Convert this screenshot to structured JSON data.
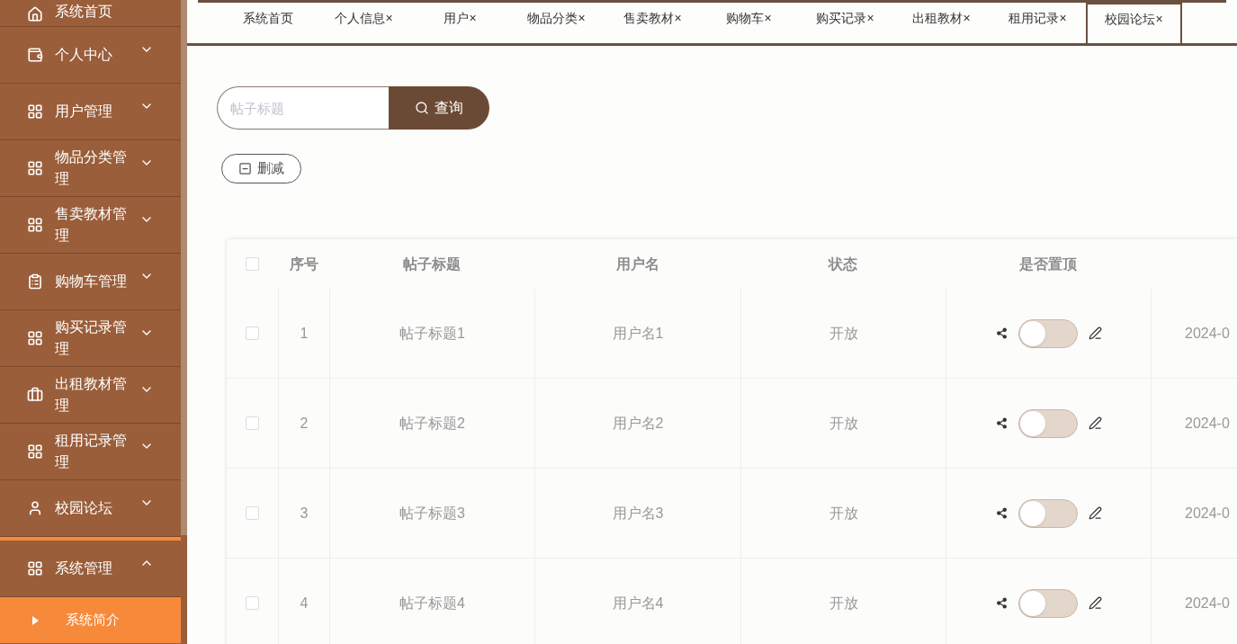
{
  "sidebar": {
    "items": [
      {
        "label": "系统首页",
        "expanded": false
      },
      {
        "label": "个人中心",
        "expanded": false
      },
      {
        "label": "用户管理",
        "expanded": false
      },
      {
        "label": "物品分类管理",
        "expanded": false
      },
      {
        "label": "售卖教材管理",
        "expanded": false
      },
      {
        "label": "购物车管理",
        "expanded": false
      },
      {
        "label": "购买记录管理",
        "expanded": false
      },
      {
        "label": "出租教材管理",
        "expanded": false
      },
      {
        "label": "租用记录管理",
        "expanded": false
      },
      {
        "label": "校园论坛",
        "expanded": false
      },
      {
        "label": "系统管理",
        "expanded": true,
        "children": [
          {
            "label": "系统简介",
            "selected": true
          }
        ]
      }
    ]
  },
  "tabs": [
    {
      "label": "系统首页",
      "selected": false
    },
    {
      "label": "个人信息",
      "close": "×",
      "selected": false
    },
    {
      "label": "用户",
      "close": "×",
      "selected": false
    },
    {
      "label": "物品分类",
      "close": "×",
      "selected": false
    },
    {
      "label": "售卖教材",
      "close": "×",
      "selected": false
    },
    {
      "label": "购物车",
      "close": "×",
      "selected": false
    },
    {
      "label": "购买记录",
      "close": "×",
      "selected": false
    },
    {
      "label": "出租教材",
      "close": "×",
      "selected": false
    },
    {
      "label": "租用记录",
      "close": "×",
      "selected": false
    },
    {
      "label": "校园论坛",
      "close": "×",
      "selected": true
    }
  ],
  "search": {
    "placeholder": "帖子标题",
    "button": "查询"
  },
  "delete_button": "删减",
  "table": {
    "select_all_checked": false,
    "columns": [
      "序号",
      "帖子标题",
      "用户名",
      "状态",
      "是否置顶"
    ],
    "rows": [
      {
        "checked": false,
        "index": "1",
        "title": "帖子标题1",
        "user": "用户名1",
        "status": "开放",
        "pinned": false,
        "column_7": "2024-0"
      },
      {
        "checked": false,
        "index": "2",
        "title": "帖子标题2",
        "user": "用户名2",
        "status": "开放",
        "pinned": false,
        "column_7": "2024-0"
      },
      {
        "checked": false,
        "index": "3",
        "title": "帖子标题3",
        "user": "用户名3",
        "status": "开放",
        "pinned": false,
        "column_7": "2024-0"
      },
      {
        "checked": false,
        "index": "4",
        "title": "帖子标题4",
        "user": "用户名4",
        "status": "开放",
        "pinned": false,
        "column_7": "2024-0"
      }
    ]
  }
}
